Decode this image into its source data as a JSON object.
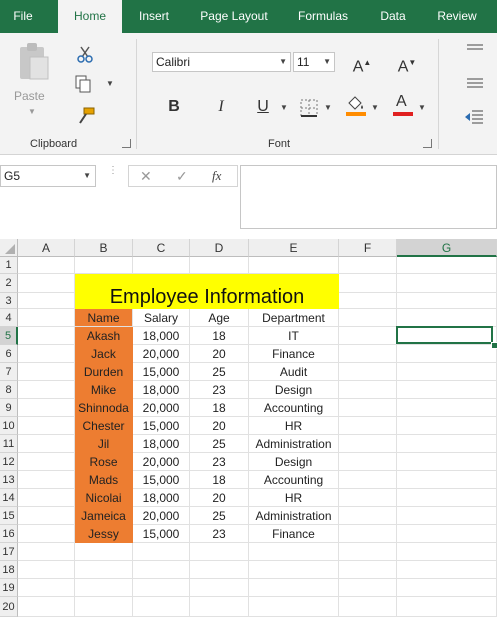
{
  "ribbon": {
    "tabs": [
      "File",
      "Home",
      "Insert",
      "Page Layout",
      "Formulas",
      "Data",
      "Review"
    ],
    "active_tab": "Home",
    "clipboard": {
      "paste_label": "Paste",
      "group_label": "Clipboard"
    },
    "font": {
      "font_name": "Calibri",
      "font_size": "11",
      "grow_label": "A",
      "shrink_label": "A",
      "bold_label": "B",
      "italic_label": "I",
      "underline_label": "U",
      "font_color_label": "A",
      "group_label": "Font",
      "fill_color": "#ff8c00",
      "font_color": "#e02020"
    }
  },
  "formula_bar": {
    "name_box": "G5",
    "cancel_label": "✕",
    "enter_label": "✓",
    "fx_label": "fx",
    "formula": ""
  },
  "sheet": {
    "columns": [
      "A",
      "B",
      "C",
      "D",
      "E",
      "F",
      "G"
    ],
    "selected_column": "G",
    "rows": [
      "1",
      "2",
      "3",
      "4",
      "5",
      "6",
      "7",
      "8",
      "9",
      "10",
      "11",
      "12",
      "13",
      "14",
      "15",
      "16",
      "17",
      "18",
      "19",
      "20"
    ],
    "selected_row": "5",
    "title": "Employee Information",
    "headers": [
      "Name",
      "Salary",
      "Age",
      "Department"
    ],
    "employees": [
      [
        "Akash",
        "18,000",
        "18",
        "IT"
      ],
      [
        "Jack",
        "20,000",
        "20",
        "Finance"
      ],
      [
        "Durden",
        "15,000",
        "25",
        "Audit"
      ],
      [
        "Mike",
        "18,000",
        "23",
        "Design"
      ],
      [
        "Shinnoda",
        "20,000",
        "18",
        "Accounting"
      ],
      [
        "Chester",
        "15,000",
        "20",
        "HR"
      ],
      [
        "Jil",
        "18,000",
        "25",
        "Administration"
      ],
      [
        "Rose",
        "20,000",
        "23",
        "Design"
      ],
      [
        "Mads",
        "15,000",
        "18",
        "Accounting"
      ],
      [
        "Nicolai",
        "18,000",
        "20",
        "HR"
      ],
      [
        "Jameica",
        "20,000",
        "25",
        "Administration"
      ],
      [
        "Jessy",
        "15,000",
        "23",
        "Finance"
      ]
    ],
    "colors": {
      "title_fill": "#ffff00",
      "name_fill": "#ed7d31",
      "accent": "#217346"
    }
  }
}
